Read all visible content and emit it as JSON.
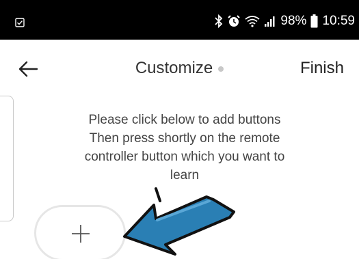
{
  "status_bar": {
    "battery_percent": "98%",
    "time": "10:59",
    "icons": [
      "checkbox-notification-icon",
      "bluetooth-icon",
      "alarm-icon",
      "wifi-icon",
      "signal-icon",
      "battery-icon"
    ]
  },
  "header": {
    "title": "Customize",
    "finish_label": "Finish"
  },
  "instructions": {
    "line1": "Please click below to add buttons",
    "line2": "Then press shortly on the remote controller button which you want to learn"
  },
  "colors": {
    "status_bar_bg": "#000000",
    "arrow_blue": "#2a7fb4",
    "arrow_outline": "#111111",
    "add_button_border": "#e6e6e6"
  }
}
